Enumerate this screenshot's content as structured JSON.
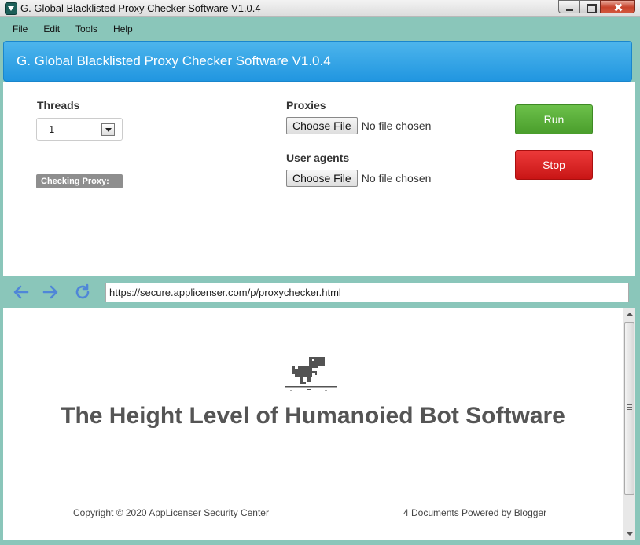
{
  "window": {
    "title": "G. Global Blacklisted Proxy Checker Software V1.0.4"
  },
  "menu": {
    "items": [
      "File",
      "Edit",
      "Tools",
      "Help"
    ]
  },
  "header": {
    "title": "G. Global Blacklisted Proxy Checker Software V1.0.4"
  },
  "form": {
    "threads_label": "Threads",
    "threads_value": "1",
    "checking_label": "Checking Proxy:",
    "proxies_label": "Proxies",
    "user_agents_label": "User agents",
    "choose_file_label": "Choose File",
    "no_file_text": "No file chosen",
    "run_label": "Run",
    "stop_label": "Stop"
  },
  "browser": {
    "url": "https://secure.applicenser.com/p/proxychecker.html",
    "headline": "The Height Level of Humanoied Bot Software",
    "copyright": "Copyright © 2020 AppLicenser Security Center",
    "powered": "4 Documents Powered by Blogger"
  },
  "colors": {
    "frame": "#8ac6ba",
    "banner": "#2196e0",
    "run": "#4a9e2c",
    "stop": "#c91515",
    "nav_icon": "#4f86d8"
  }
}
